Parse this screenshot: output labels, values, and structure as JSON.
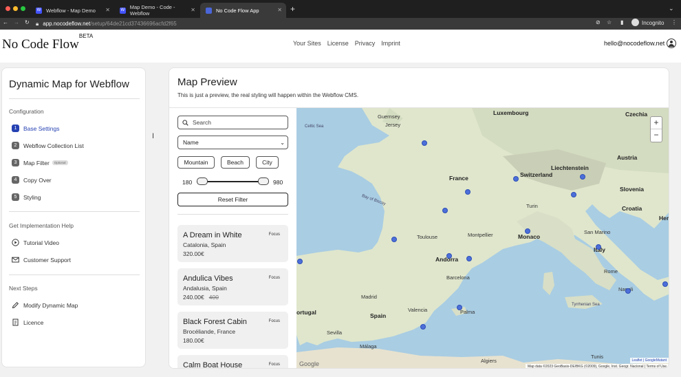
{
  "browser": {
    "tabs": [
      {
        "label": "Webflow - Map Demo"
      },
      {
        "label": "Map Demo - Code - Webflow"
      },
      {
        "label": "No Code Flow App"
      }
    ],
    "url_host": "app.nocodeflow.net",
    "url_path": "/setup/64de21cd37436696acfd2f65",
    "profile_label": "Incognito",
    "new_tab": "+"
  },
  "header": {
    "logo": "No Code Flow",
    "logo_badge": "BETA",
    "nav": [
      "Your Sites",
      "License",
      "Privacy",
      "Imprint"
    ],
    "email": "hello@nocodeflow.net"
  },
  "sidebar": {
    "title": "Dynamic Map for Webflow",
    "config_label": "Configuration",
    "steps": [
      {
        "num": "1",
        "label": "Base Settings"
      },
      {
        "num": "2",
        "label": "Webflow Collection List"
      },
      {
        "num": "3",
        "label": "Map Filter",
        "badge": "Optional"
      },
      {
        "num": "4",
        "label": "Copy Over"
      },
      {
        "num": "5",
        "label": "Styling"
      }
    ],
    "help_label": "Get Implementation Help",
    "help_items": [
      {
        "label": "Tutorial Video",
        "icon": "play-icon"
      },
      {
        "label": "Customer Support",
        "icon": "mail-icon"
      }
    ],
    "next_label": "Next Steps",
    "next_items": [
      {
        "label": "Modify Dynamic Map",
        "icon": "pen-icon"
      },
      {
        "label": "Licence",
        "icon": "document-icon"
      }
    ]
  },
  "main": {
    "title": "Map Preview",
    "subtitle": "This is just a preview, the real styling will happen within the Webflow CMS."
  },
  "filters": {
    "search_placeholder": "Search",
    "sort_value": "Name",
    "chips": [
      "Mountain",
      "Beach",
      "City"
    ],
    "price_min": "180",
    "price_max": "980",
    "reset_label": "Reset Filter"
  },
  "listings": [
    {
      "title": "A Dream in White",
      "location": "Catalonia, Spain",
      "price": "320.00€",
      "old_price": "",
      "focus": "Focus"
    },
    {
      "title": "Andulica Vibes",
      "location": "Andalusia, Spain",
      "price": "240.00€",
      "old_price": "400",
      "focus": "Focus"
    },
    {
      "title": "Black Forest Cabin",
      "location": "Brocéliande, France",
      "price": "180.00€",
      "old_price": "",
      "focus": "Focus"
    },
    {
      "title": "Calm Boat House",
      "location": "",
      "price": "",
      "old_price": "",
      "focus": "Focus"
    }
  ],
  "map": {
    "labels": {
      "luxembourg": "Luxembourg",
      "czechia": "Czechia",
      "jersey": "Jersey",
      "guernsey": "Guernsey",
      "celtic_sea": "Celtic Sea",
      "france": "France",
      "switzerland": "Switzerland",
      "liechtenstein": "Liechtenstein",
      "austria": "Austria",
      "slovenia": "Slovenia",
      "croatia": "Croatia",
      "herz": "Herz",
      "bay_of_biscay": "Bay of Biscay",
      "turin": "Turin",
      "monaco": "Monaco",
      "san_marino": "San Marino",
      "toulouse": "Toulouse",
      "montpellier": "Montpellier",
      "italy": "Italy",
      "andorra": "Andorra",
      "barcelona": "Barcelona",
      "rome": "Rome",
      "madrid": "Madrid",
      "tyrrhenian_sea": "Tyrrhenian Sea",
      "napoli": "Napoli",
      "portugal": "ortugal",
      "spain": "Spain",
      "palma": "Palma",
      "valencia": "Valencia",
      "sevilla": "Sevilla",
      "malaga": "Málaga",
      "algiers": "Algiers",
      "tunis": "Tunis",
      "google": "Google"
    },
    "zoom_in": "+",
    "zoom_out": "−",
    "attribution_leaflet": "Leaflet | GoogleMutant",
    "attribution_data": "Map data ©2023 GeoBasis-DE/BKG (©2009), Google, Inst. Geogr. Nacional",
    "attribution_terms": "Terms of Use"
  }
}
